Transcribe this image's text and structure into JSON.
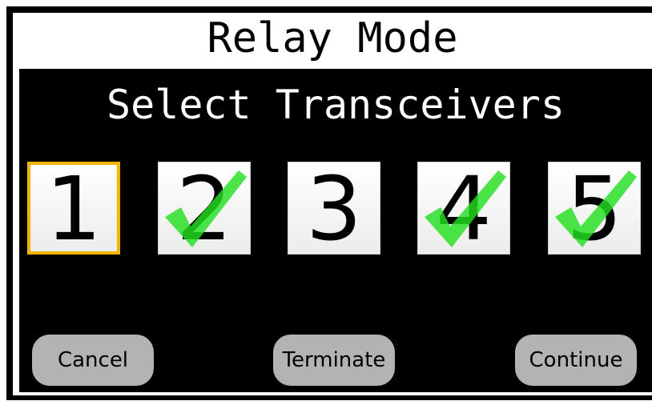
{
  "window": {
    "title": "Relay Mode"
  },
  "main": {
    "heading": "Select Transceivers",
    "transceivers": [
      {
        "label": "1",
        "checked": false,
        "selected": true
      },
      {
        "label": "2",
        "checked": true,
        "selected": false
      },
      {
        "label": "3",
        "checked": false,
        "selected": false
      },
      {
        "label": "4",
        "checked": true,
        "selected": false
      },
      {
        "label": "5",
        "checked": true,
        "selected": false
      }
    ]
  },
  "buttons": {
    "cancel": "Cancel",
    "terminate": "Terminate",
    "continue": "Continue"
  },
  "colors": {
    "selection_border": "#f2b400",
    "check": "#22e01e",
    "button_bg": "#b3b3b3",
    "screen_bg": "#000000"
  },
  "icons": {
    "checked": "checkmark-icon"
  }
}
